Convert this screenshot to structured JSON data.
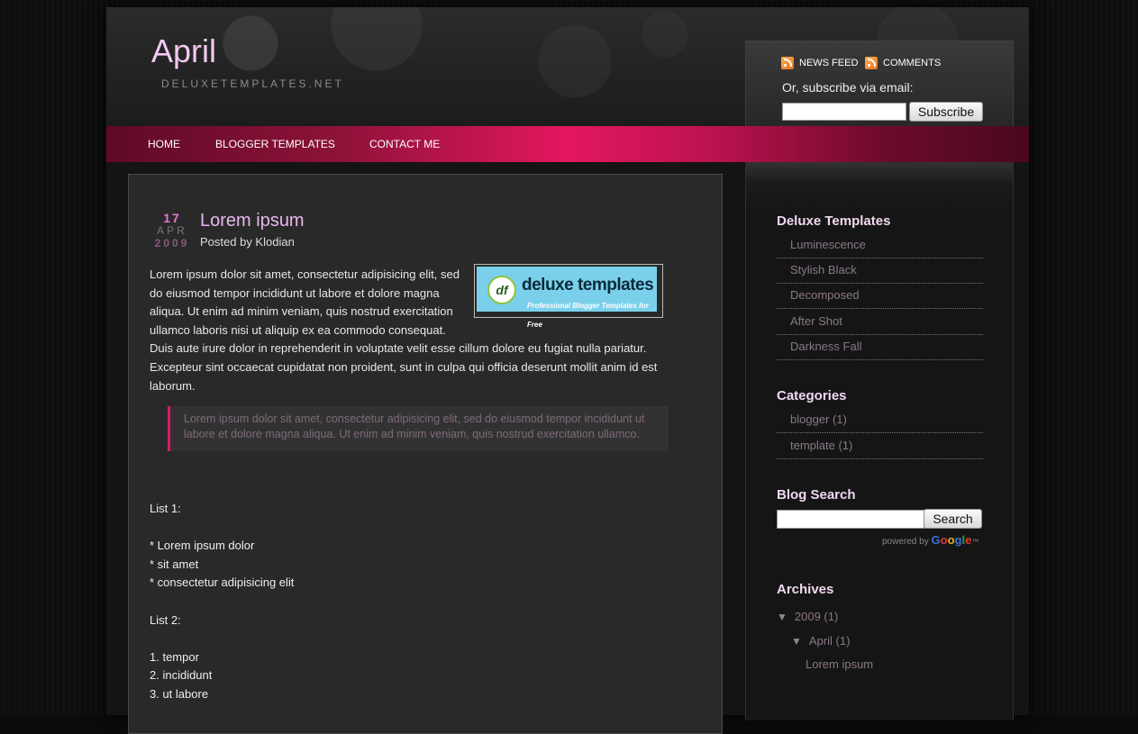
{
  "header": {
    "title": "April",
    "subtitle": "DELUXETEMPLATES.NET",
    "news_feed": "NEWS FEED",
    "comments": "COMMENTS",
    "subscribe_text": "Or, subscribe via email:",
    "subscribe_button": "Subscribe",
    "subscribe_value": ""
  },
  "nav": {
    "items": [
      {
        "label": "HOME"
      },
      {
        "label": "BLOGGER TEMPLATES"
      },
      {
        "label": "CONTACT ME"
      }
    ]
  },
  "post": {
    "day": "17",
    "month": "APR",
    "year": "2009",
    "title": "Lorem ipsum",
    "byline": "Posted by Klodian",
    "paragraph": "Lorem ipsum dolor sit amet, consectetur adipisicing elit, sed do eiusmod tempor incididunt ut labore et dolore magna aliqua. Ut enim ad minim veniam, quis nostrud exercitation ullamco laboris nisi ut aliquip ex ea commodo consequat. Duis aute irure dolor in reprehenderit in voluptate velit esse cillum dolore eu fugiat nulla pariatur. Excepteur sint occaecat cupidatat non proident, sunt in culpa qui officia deserunt mollit anim id est laborum.",
    "image": {
      "logo_letters": "df",
      "logo_main": "deluxe templates",
      "logo_tagline": "Professional Blogger Templates for Free"
    },
    "quote": "Lorem ipsum dolor sit amet, consectetur adipisicing elit, sed do eiusmod tempor incididunt ut labore et dolore magna aliqua. Ut enim ad minim veniam, quis nostrud exercitation ullamco.",
    "list1_title": "List 1:",
    "list1": [
      "* Lorem ipsum dolor",
      "* sit amet",
      "* consectetur adipisicing elit"
    ],
    "list2_title": "List 2:",
    "list2": [
      "1. tempor",
      "2. incididunt",
      "3. ut labore"
    ]
  },
  "sidebar": {
    "deluxe": {
      "title": "Deluxe Templates",
      "items": [
        "Luminescence",
        "Stylish Black",
        "Decomposed",
        "After Shot",
        "Darkness Fall"
      ]
    },
    "categories": {
      "title": "Categories",
      "items": [
        "blogger (1)",
        "template (1)"
      ]
    },
    "search": {
      "title": "Blog Search",
      "button": "Search",
      "value": "",
      "powered": "powered by",
      "google": [
        "G",
        "o",
        "o",
        "g",
        "l",
        "e"
      ],
      "tm": "™"
    },
    "archives": {
      "title": "Archives",
      "year": "2009 (1)",
      "month": "April (1)",
      "post": "Lorem ipsum"
    }
  }
}
